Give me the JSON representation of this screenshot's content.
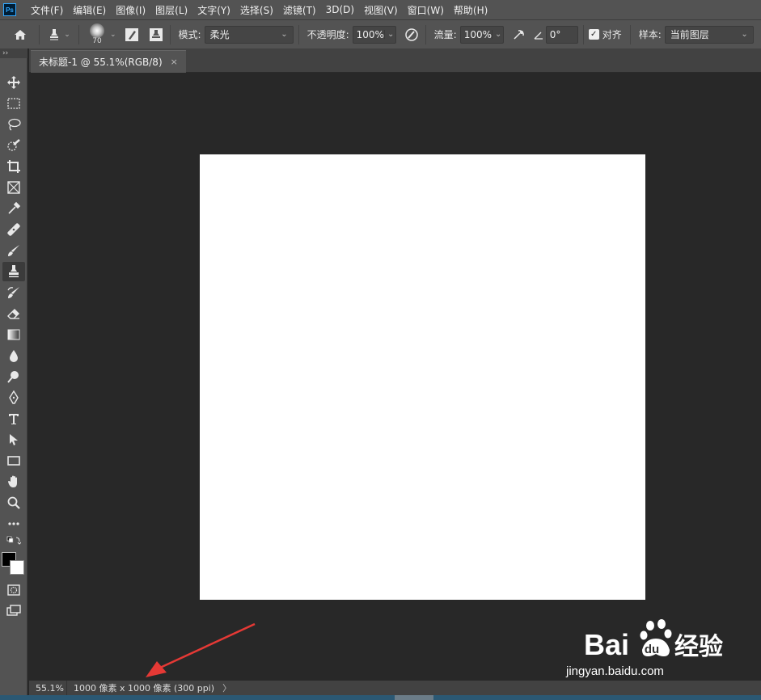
{
  "menu": {
    "items": [
      "文件(F)",
      "编辑(E)",
      "图像(I)",
      "图层(L)",
      "文字(Y)",
      "选择(S)",
      "滤镜(T)",
      "3D(D)",
      "视图(V)",
      "窗口(W)",
      "帮助(H)"
    ]
  },
  "options": {
    "brush_size": "70",
    "mode_label": "模式:",
    "mode_value": "柔光",
    "opacity_label": "不透明度:",
    "opacity_value": "100%",
    "flow_label": "流量:",
    "flow_value": "100%",
    "angle_value": "0°",
    "aligned_label": "对齐",
    "aligned_checked": true,
    "sample_label": "样本:",
    "sample_value": "当前图层"
  },
  "toolbar": {
    "header": "››",
    "active_tool": "clone-stamp",
    "foreground_color": "#000000",
    "background_color": "#ffffff"
  },
  "document": {
    "tab_title": "未标题-1 @ 55.1%(RGB/8)",
    "tab_close": "×",
    "canvas_color": "#ffffff"
  },
  "status": {
    "zoom": "55.1%",
    "doc_info": "1000 像素 x 1000 像素 (300 ppi)",
    "arrow": "〉"
  },
  "annotation": {
    "arrow_color": "#e53935"
  },
  "watermark": {
    "brand_left": "Bai",
    "brand_right": "经验",
    "url": "jingyan.baidu.com"
  }
}
